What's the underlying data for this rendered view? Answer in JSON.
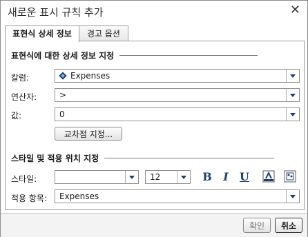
{
  "dialog": {
    "title": "새로운 표시 규칙 추가",
    "close_label": "✕"
  },
  "tabs": [
    {
      "label": "표현식 상세 정보",
      "active": true
    },
    {
      "label": "경고 옵션",
      "active": false
    }
  ],
  "expression_section": {
    "heading": "표현식에 대한 상세 정보 지정",
    "column_label": "칼럼:",
    "column_value": "Expenses",
    "column_icon": "measure-icon",
    "operator_label": "연산자:",
    "operator_value": ">",
    "value_label": "값:",
    "value_value": "0",
    "intersection_button": "교차점 지정..."
  },
  "style_section": {
    "heading": "스타일 및 적용 위치 지정",
    "style_label": "스타일:",
    "style_value": "",
    "font_size_value": "12",
    "bold_label": "B",
    "italic_label": "I",
    "underline_label": "U",
    "apply_label": "적용 항목:",
    "apply_value": "Expenses"
  },
  "footer": {
    "ok_label": "확인",
    "cancel_label": "취소"
  },
  "colors": {
    "accent": "#1e3f6e",
    "border": "#8f8f8f"
  }
}
